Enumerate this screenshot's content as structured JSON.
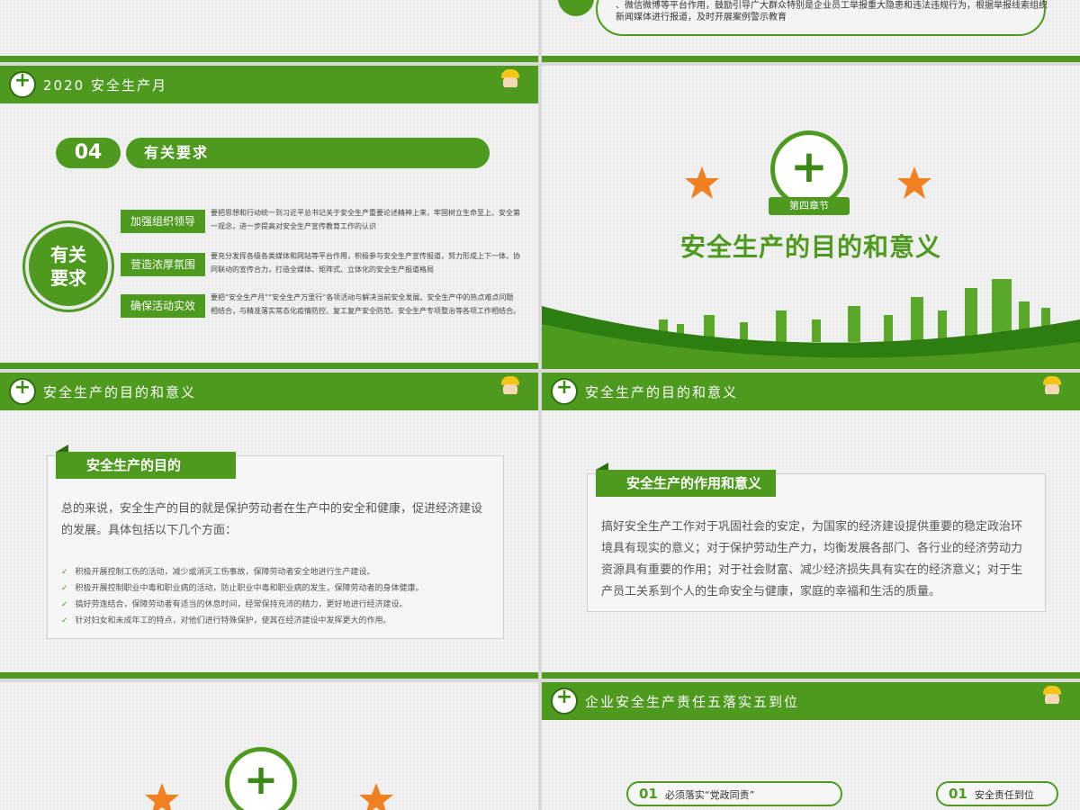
{
  "slide_top_right": {
    "text": "、微信微博等平台作用，鼓励引导广大群众特别是企业员工举报重大隐患和违法违规行为，根据举报线索组织新闻媒体进行报道，及时开展案例警示教育"
  },
  "slide_requirements": {
    "header_title": "2020 安全生产月",
    "number": "04",
    "title": "有关要求",
    "circle_text_line1": "有关",
    "circle_text_line2": "要求",
    "items": [
      {
        "label": "加强组织领导",
        "text": "要把思想和行动统一到习近平总书记关于安全生产重要论述精神上来，牢固树立生命至上、安全第一观念，进一步提高对安全生产宣传教育工作的认识"
      },
      {
        "label": "营造浓厚氛围",
        "text": "要充分发挥各级各类媒体和网站等平台作用，积极参与安全生产宣传报道，努力形成上下一体、协同联动的宣传合力，打造全媒体、矩阵式、立体化的安全生产报道格局"
      },
      {
        "label": "确保活动实效",
        "text": "要把“安全生产月”“安全生产万里行”各项活动与解决当前安全发展、安全生产中的热点难点问题相结合，与精准落实常态化疫情防控、复工复产安全防范、安全生产专项整治等各项工作相结合。"
      }
    ]
  },
  "slide_chapter": {
    "chapter_label": "第四章节",
    "title": "安全生产的目的和意义"
  },
  "slide_purpose": {
    "header_title": "安全生产的目的和意义",
    "ribbon": "安全生产的目的",
    "intro": "总的来说，安全生产的目的就是保护劳动者在生产中的安全和健康，促进经济建设的发展。具体包括以下几个方面：",
    "bullets": [
      "积极开展控制工伤的活动，减少或消灭工伤事故，保障劳动者安全地进行生产建设。",
      "积极开展控制职业中毒和职业病的活动，防止职业中毒和职业病的发生，保障劳动者的身体健康。",
      "搞好劳逸结合，保障劳动者有适当的休息时间，经常保持充沛的精力，更好地进行经济建设。",
      "针对妇女和未成年工的特点，对他们进行特殊保护，使其在经济建设中发挥更大的作用。"
    ]
  },
  "slide_role": {
    "header_title": "安全生产的目的和意义",
    "ribbon": "安全生产的作用和意义",
    "body": "搞好安全生产工作对于巩固社会的安定，为国家的经济建设提供重要的稳定政治环境具有现实的意义；对于保护劳动生产力，均衡发展各部门、各行业的经济劳动力资源具有重要的作用；对于社会财富、减少经济损失具有实在的经济意义；对于生产员工关系到个人的生命安全与健康，家庭的幸福和生活的质量。"
  },
  "slide_responsibility": {
    "header_title": "企业安全生产责任五落实五到位",
    "pill1_num": "01",
    "pill1_text": "必须落实“党政同责”",
    "pill2_num": "01",
    "pill2_text": "安全责任到位"
  },
  "colors": {
    "brand_green": "#4d9a1e",
    "star_orange": "#f08020"
  }
}
